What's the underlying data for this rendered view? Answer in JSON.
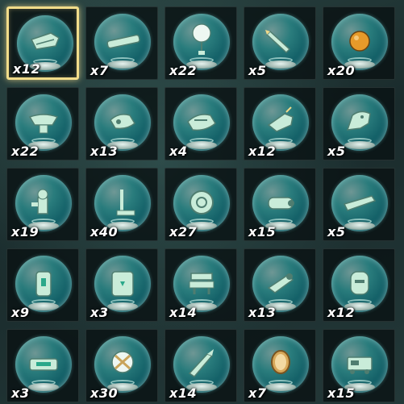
{
  "inventory": {
    "selected_index": 0,
    "items": [
      {
        "icon": "wing-icon",
        "count": "x12"
      },
      {
        "icon": "sled-icon",
        "count": "x7"
      },
      {
        "icon": "balloon-icon",
        "count": "x22"
      },
      {
        "icon": "rocket-icon",
        "count": "x5"
      },
      {
        "icon": "orb-icon",
        "count": "x20"
      },
      {
        "icon": "bowl-icon",
        "count": "x22"
      },
      {
        "icon": "flame-emitter-icon",
        "count": "x13"
      },
      {
        "icon": "frost-emitter-icon",
        "count": "x4"
      },
      {
        "icon": "shock-emitter-icon",
        "count": "x12"
      },
      {
        "icon": "dragon-head-icon",
        "count": "x5"
      },
      {
        "icon": "hydrant-icon",
        "count": "x19"
      },
      {
        "icon": "lever-stick-icon",
        "count": "x40"
      },
      {
        "icon": "wheel-icon",
        "count": "x27"
      },
      {
        "icon": "cannon-icon",
        "count": "x15"
      },
      {
        "icon": "board-icon",
        "count": "x5"
      },
      {
        "icon": "battery-icon",
        "count": "x9"
      },
      {
        "icon": "big-battery-icon",
        "count": "x3"
      },
      {
        "icon": "spring-icon",
        "count": "x14"
      },
      {
        "icon": "beam-cannon-icon",
        "count": "x13"
      },
      {
        "icon": "construct-head-icon",
        "count": "x12"
      },
      {
        "icon": "stabilizer-icon",
        "count": "x3"
      },
      {
        "icon": "fan-icon",
        "count": "x30"
      },
      {
        "icon": "spike-icon",
        "count": "x14"
      },
      {
        "icon": "mirror-icon",
        "count": "x7"
      },
      {
        "icon": "cart-icon",
        "count": "x15"
      }
    ]
  },
  "colors": {
    "capsule": "#3fbdbd",
    "device": "#c9ecd9",
    "device_dark": "#4f7d70",
    "selection": "#f1dc8a",
    "count_text": "#ffffff"
  }
}
